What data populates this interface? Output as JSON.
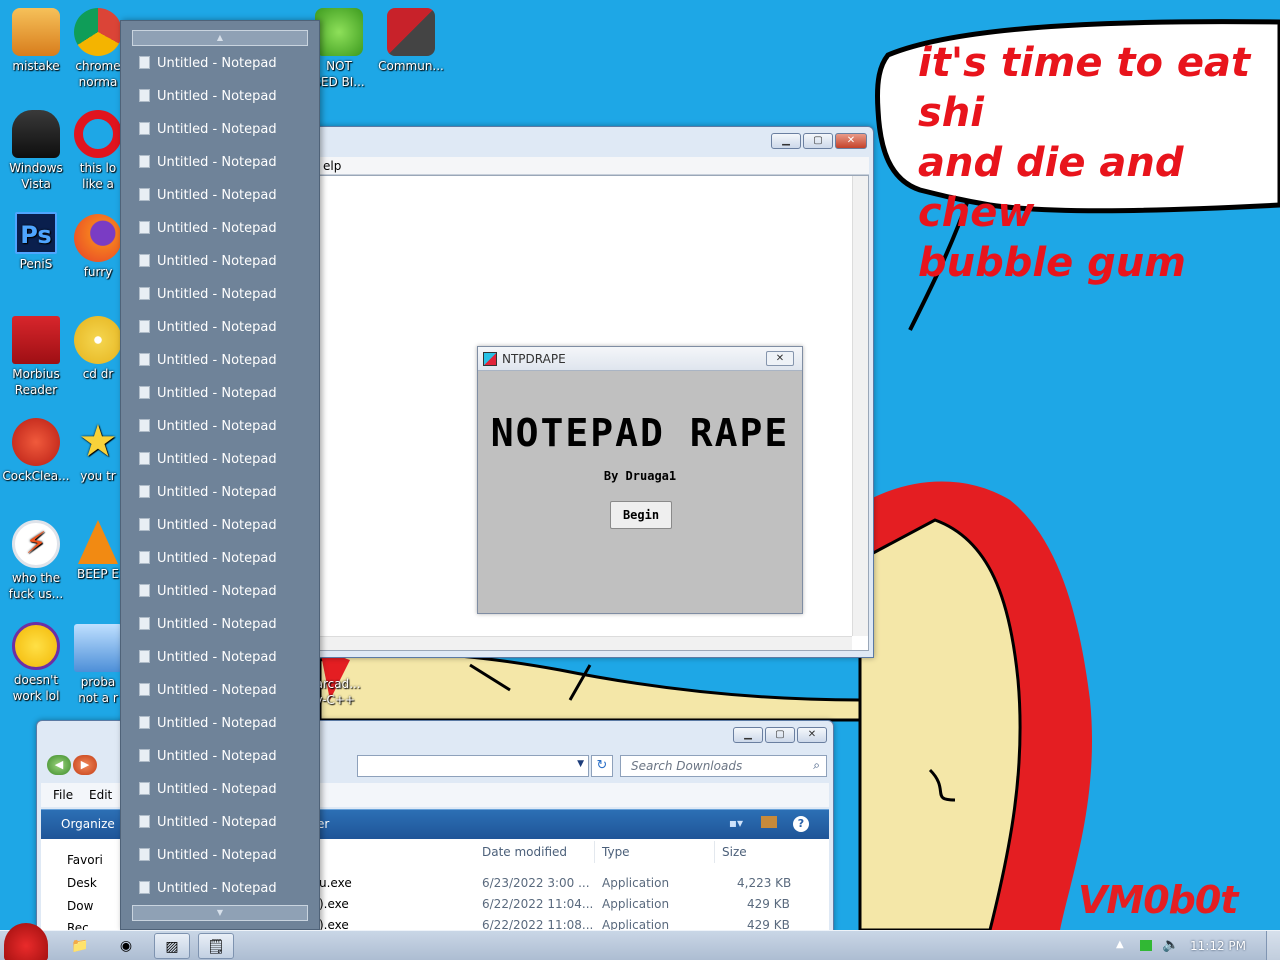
{
  "desktop": {
    "speech_bubble": "it's time to eat shi\nand die and chew\nbubble gum",
    "signature": "VM0b0t",
    "icons": [
      {
        "label": "mistake",
        "icon": "computer-icon"
      },
      {
        "label": "chrome\nnorma",
        "icon": "chrome-icon"
      },
      {
        "label": "NOT\nSED BI...",
        "icon": "angry-pig-icon"
      },
      {
        "label": "Commun...",
        "icon": "community-icon"
      },
      {
        "label": "Windows\nVista",
        "icon": "trash-bin-icon"
      },
      {
        "label": "this lo\nlike a",
        "icon": "opera-icon"
      },
      {
        "label": "PeniS",
        "icon": "photoshop-icon"
      },
      {
        "label": "furry",
        "icon": "firefox-icon"
      },
      {
        "label": "Morbius\nReader",
        "icon": "pdf-reader-icon"
      },
      {
        "label": "cd dr",
        "icon": "cd-icon"
      },
      {
        "label": "CockClea...",
        "icon": "ccleaner-icon"
      },
      {
        "label": "you tr",
        "icon": "star-icon"
      },
      {
        "label": "who the\nfuck us...",
        "icon": "lightning-icon"
      },
      {
        "label": "BEEP E",
        "icon": "vlc-cone-icon"
      },
      {
        "label": "doesn't\nwork lol",
        "icon": "yahoo-messenger-icon"
      },
      {
        "label": "proba\nnot a r",
        "icon": "installer-icon"
      },
      {
        "label": "barcad...\nev-C++",
        "icon": "devcpp-icon"
      }
    ]
  },
  "notepad_window": {
    "menu_partial": "elp"
  },
  "ntpdrape": {
    "title": "NTPDRAPE",
    "heading": "NOTEPAD RAPE",
    "byline": "By Druaga1",
    "begin_label": "Begin",
    "close_glyph": "✕"
  },
  "jumplist": {
    "items": [
      "Untitled - Notepad",
      "Untitled - Notepad",
      "Untitled - Notepad",
      "Untitled - Notepad",
      "Untitled - Notepad",
      "Untitled - Notepad",
      "Untitled - Notepad",
      "Untitled - Notepad",
      "Untitled - Notepad",
      "Untitled - Notepad",
      "Untitled - Notepad",
      "Untitled - Notepad",
      "Untitled - Notepad",
      "Untitled - Notepad",
      "Untitled - Notepad",
      "Untitled - Notepad",
      "Untitled - Notepad",
      "Untitled - Notepad",
      "Untitled - Notepad",
      "Untitled - Notepad",
      "Untitled - Notepad",
      "Untitled - Notepad",
      "Untitled - Notepad",
      "Untitled - Notepad",
      "Untitled - Notepad",
      "Untitled - Notepad"
    ]
  },
  "explorer": {
    "search_placeholder": "Search Downloads",
    "menu": {
      "file": "File",
      "edit": "Edit"
    },
    "organize": "Organize",
    "cmd_partial": "er",
    "tree": [
      "Favori",
      "Desk",
      "Dow",
      "Rec"
    ],
    "columns": {
      "date": "Date modified",
      "type": "Type",
      "size": "Size"
    },
    "rows": [
      {
        "name": "u.exe",
        "date": "6/23/2022 3:00 ...",
        "type": "Application",
        "size": "4,223 KB"
      },
      {
        "name": ").exe",
        "date": "6/22/2022 11:04...",
        "type": "Application",
        "size": "429 KB"
      },
      {
        "name": ").exe",
        "date": "6/22/2022 11:08...",
        "type": "Application",
        "size": "429 KB"
      }
    ]
  },
  "taskbar": {
    "clock": "11:12 PM",
    "buttons": [
      "angry-bird-start-icon",
      "explorer-icon",
      "chrome-icon",
      "ntpdrape-icon",
      "notepad-icon"
    ]
  },
  "colors": {
    "desktop": "#1ea7e6",
    "bubble_text": "#e8141c",
    "jumplist_bg": "#6f8399"
  }
}
